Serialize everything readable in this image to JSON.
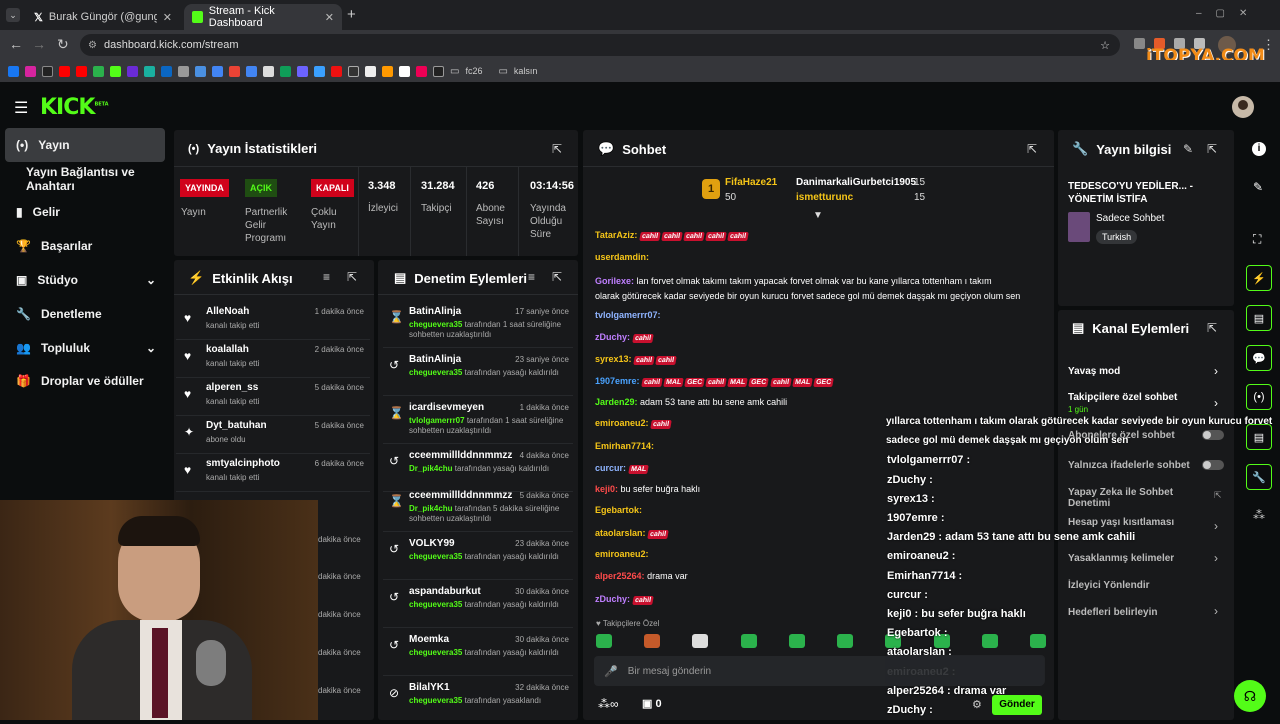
{
  "browser": {
    "tabs": [
      {
        "label": "Burak Güngör (@gungorburak)"
      },
      {
        "label": "Stream - Kick Dashboard"
      }
    ],
    "url": "dashboard.kick.com/stream",
    "bookmarks": [
      "fc26",
      "kalsın"
    ],
    "watermark": "iTOPYA.COM"
  },
  "header": {
    "logo": "KICK",
    "logo_beta": "BETA"
  },
  "sidebar": {
    "items": [
      {
        "label": "Yayın"
      },
      {
        "label": "Yayın Bağlantısı ve Anahtarı"
      },
      {
        "label": "Gelir"
      },
      {
        "label": "Başarılar"
      },
      {
        "label": "Stüdyo"
      },
      {
        "label": "Denetleme"
      },
      {
        "label": "Topluluk"
      },
      {
        "label": "Droplar ve ödüller"
      }
    ]
  },
  "stats": {
    "title": "Yayın İstatistikleri",
    "live_badge": "YAYINDA",
    "live_label": "Yayın",
    "partner_badge": "AÇIK",
    "partner_label": "Partnerlik Gelir Programı",
    "multi_badge": "KAPALI",
    "multi_label": "Çoklu Yayın",
    "viewers": "3.348",
    "viewers_label": "İzleyici",
    "followers": "31.284",
    "followers_label": "Takipçi",
    "subs": "426",
    "subs_label": "Abone Sayısı",
    "uptime": "03:14:56",
    "uptime_label": "Yayında Olduğu Süre"
  },
  "activity": {
    "title": "Etkinlik Akışı",
    "items": [
      {
        "name": "AlleNoah",
        "sub": "kanalı takip etti",
        "time": "1 dakika önce"
      },
      {
        "name": "koalallah",
        "sub": "kanalı takip etti",
        "time": "2 dakika önce"
      },
      {
        "name": "alperen_ss",
        "sub": "kanalı takip etti",
        "time": "5 dakika önce"
      },
      {
        "name": "Dyt_batuhan",
        "sub": "abone oldu",
        "time": "5 dakika önce"
      },
      {
        "name": "smtyalcinphoto",
        "sub": "kanalı takip etti",
        "time": "6 dakika önce"
      }
    ],
    "more_times": [
      "dakika önce",
      "dakika önce",
      "dakika önce",
      "dakika önce",
      "dakika önce",
      "dakika önce"
    ]
  },
  "moderation": {
    "title": "Denetim Eylemleri",
    "items": [
      {
        "name": "BatinAlinja",
        "mod": "cheguevera35",
        "text": " tarafından 1 saat süreliğine sohbetten uzaklaştırıldı",
        "time": "17 saniye önce"
      },
      {
        "name": "BatinAlinja",
        "mod": "cheguevera35",
        "text": " tarafından yasağı kaldırıldı",
        "time": "23 saniye önce"
      },
      {
        "name": "icardisevmeyen",
        "mod": "tvlolgamerrr07",
        "text": " tarafından 1 saat süreliğine sohbetten uzaklaştırıldı",
        "time": "1 dakika önce"
      },
      {
        "name": "cceemmilllddnnmmzz",
        "mod": "Dr_pik4chu",
        "text": " tarafından yasağı kaldırıldı",
        "time": "4 dakika önce"
      },
      {
        "name": "cceemmilllddnnmmzz",
        "mod": "Dr_pik4chu",
        "text": " tarafından 5 dakika süreliğine sohbetten uzaklaştırıldı",
        "time": "5 dakika önce"
      },
      {
        "name": "VOLKY99",
        "mod": "cheguevera35",
        "text": " tarafından yasağı kaldırıldı",
        "time": "23 dakika önce"
      },
      {
        "name": "aspandaburkut",
        "mod": "cheguevera35",
        "text": " tarafından yasağı kaldırıldı",
        "time": "30 dakika önce"
      },
      {
        "name": "Moemka",
        "mod": "cheguevera35",
        "text": " tarafından yasağı kaldırıldı",
        "time": "30 dakika önce"
      },
      {
        "name": "BilalYK1",
        "mod": "cheguevera35",
        "text": " tarafından yasaklandı",
        "time": "32 dakika önce"
      }
    ]
  },
  "chat": {
    "title": "Sohbet",
    "top_gifter": {
      "name": "FifaHaze21",
      "count": "50",
      "rank": "1"
    },
    "gifters": [
      {
        "name": "DanimarkaliGurbetci1905",
        "count": "15"
      },
      {
        "name": "ismetturunc",
        "count": "15"
      }
    ],
    "messages": [
      {
        "user": "TatarAziz:",
        "text": "",
        "emotes": [
          "cahil",
          "cahil",
          "cahil",
          "cahil",
          "cahil"
        ],
        "color": "#f5c518"
      },
      {
        "user": "userdamdin:",
        "text": "",
        "emotes": [],
        "color": "#f5c518"
      },
      {
        "user": "Gorilexe:",
        "text": "lan forvet olmak takımı takım yapacak forvet olmak var bu kane yıllarca tottenham ı takım",
        "text2": "olarak götürecek kadar seviyede bir oyun kurucu forvet sadece gol mü demek daşşak mı geçiyon olum sen",
        "emotes": [],
        "color": "#bf7fff"
      },
      {
        "user": "tvlolgamerrr07:",
        "text": "",
        "emotes": [],
        "color": "#8fb4ff"
      },
      {
        "user": "zDuchy:",
        "text": "",
        "emotes": [
          "cahil"
        ],
        "color": "#bf7fff"
      },
      {
        "user": "syrex13:",
        "text": "",
        "emotes": [
          "cahil",
          "cahil"
        ],
        "color": "#f5c518"
      },
      {
        "user": "1907emre:",
        "text": "",
        "emotes": [
          "cahil",
          "MAL",
          "GEC",
          "cahil",
          "MAL",
          "GEC",
          "cahil",
          "MAL",
          "GEC"
        ],
        "color": "#4aa3ff"
      },
      {
        "user": "Jarden29:",
        "text": "adam 53 tane attı bu sene amk cahili",
        "emotes": [],
        "color": "#53fc18"
      },
      {
        "user": "emiroaneu2:",
        "text": "",
        "emotes": [
          "cahil"
        ],
        "color": "#f5c518"
      },
      {
        "user": "Emirhan7714:",
        "text": "",
        "emotes": [],
        "color": "#f5c518"
      },
      {
        "user": "curcur:",
        "text": "",
        "emotes": [
          "MAL"
        ],
        "color": "#8fb4ff"
      },
      {
        "user": "keji0:",
        "text": "bu sefer buğra haklı",
        "emotes": [],
        "color": "#ff4b4b"
      },
      {
        "user": "Egebartok:",
        "text": "",
        "emotes": [],
        "color": "#f5c518"
      },
      {
        "user": "ataolarslan:",
        "text": "",
        "emotes": [
          "cahil"
        ],
        "color": "#f5c518"
      },
      {
        "user": "emiroaneu2:",
        "text": "",
        "emotes": [],
        "color": "#f5c518"
      },
      {
        "user": "alper25264:",
        "text": "drama var",
        "emotes": [],
        "color": "#ff4b4b"
      },
      {
        "user": "zDuchy:",
        "text": "",
        "emotes": [
          "cahil"
        ],
        "color": "#bf7fff"
      }
    ],
    "followers_only": "Takipçilere Özel",
    "placeholder": "Bir mesaj gönderin",
    "points": "0"
  },
  "overlay": {
    "lines": [
      {
        "user": "",
        "text": "yıllarca tottenham ı takım olarak götürecek kadar seviyede bir oyun kurucu forvet"
      },
      {
        "user": "",
        "text": "sadece gol mü demek daşşak mı geçiyon olum sen"
      },
      {
        "user": "tvlolgamerrr07",
        "text": ""
      },
      {
        "user": "zDuchy",
        "text": ""
      },
      {
        "user": "syrex13",
        "text": ""
      },
      {
        "user": "1907emre",
        "text": ""
      },
      {
        "user": "Jarden29",
        "text": "adam 53 tane attı bu sene amk cahili"
      },
      {
        "user": "emiroaneu2",
        "text": ""
      },
      {
        "user": "Emirhan7714",
        "text": ""
      },
      {
        "user": "curcur",
        "text": ""
      },
      {
        "user": "keji0",
        "text": "bu sefer buğra haklı"
      },
      {
        "user": "Egebartok",
        "text": ""
      },
      {
        "user": "ataolarslan",
        "text": ""
      },
      {
        "user": "emiroaneu2",
        "text": ""
      },
      {
        "user": "alper25264",
        "text": "drama var"
      },
      {
        "user": "zDuchy",
        "text": ""
      }
    ],
    "send": "Gönder"
  },
  "stream_info": {
    "title": "Yayın bilgisi",
    "stream_title": "TEDESCO'YU YEDİLER... - YÖNETİM İSTİFA",
    "category": "Sadece Sohbet",
    "tag": "Turkish"
  },
  "channel_actions": {
    "title": "Kanal Eylemleri",
    "items": [
      {
        "label": "Yavaş mod",
        "sub": ""
      },
      {
        "label": "Takipçilere özel sohbet",
        "sub": "1 gün"
      },
      {
        "label": "Abonelere özel sohbet",
        "sub": ""
      },
      {
        "label": "Yalnızca ifadelerle sohbet",
        "sub": ""
      },
      {
        "label": "Yapay Zeka ile Sohbet Denetimi",
        "sub": ""
      },
      {
        "label": "Hesap yaşı kısıtlaması",
        "sub": ""
      },
      {
        "label": "Yasaklanmış kelimeler",
        "sub": ""
      },
      {
        "label": "İzleyici Yönlendir",
        "sub": ""
      },
      {
        "label": "Hedefleri belirleyin",
        "sub": ""
      }
    ]
  }
}
